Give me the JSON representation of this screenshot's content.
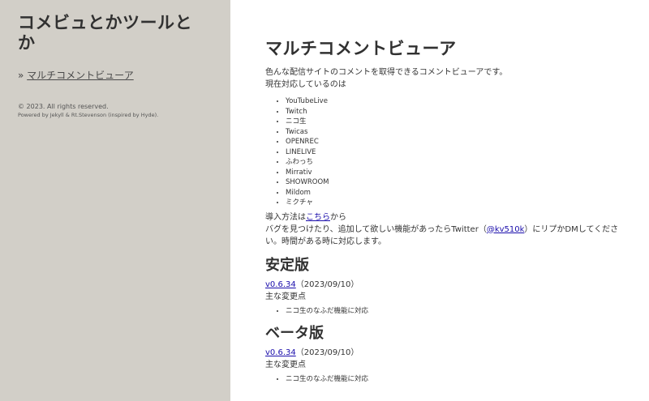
{
  "sidebar": {
    "site_title": "コメビュとかツールとか",
    "nav_prefix": "»",
    "nav_link": "マルチコメントビューア",
    "copyright": "© 2023. All rights reserved.",
    "powered_by": "Powered by Jekyll & Rt.Stevenson (inspired by Hyde)."
  },
  "main": {
    "title": "マルチコメントビューア",
    "intro_line1": "色んな配信サイトのコメントを取得できるコメントビューアです。",
    "intro_line2": "現在対応しているのは",
    "services": [
      "YouTubeLive",
      "Twitch",
      "ニコ生",
      "Twicas",
      "OPENREC",
      "LINELIVE",
      "ふわっち",
      "Mirrativ",
      "SHOWROOM",
      "Mildom",
      "ミクチャ"
    ],
    "install_prefix": "導入方法は",
    "install_link": "こちら",
    "install_suffix": "から",
    "bug_prefix": "バグを見つけたり、追加して欲しい機能があったらTwitter（",
    "twitter_link": "@kv510k",
    "bug_suffix": "）にリプかDMしてください。時間がある時に対応します。",
    "stable": {
      "heading": "安定版",
      "version_link": "v0.6.34",
      "date": "（2023/09/10）",
      "changes_label": "主な変更点",
      "changes": [
        "ニコ生のなふだ機能に対応"
      ]
    },
    "beta": {
      "heading": "ベータ版",
      "version_link": "v0.6.34",
      "date": "（2023/09/10）",
      "changes_label": "主な変更点",
      "changes": [
        "ニコ生のなふだ機能に対応"
      ]
    }
  },
  "colors": {
    "sidebar_bg": "#d2cfc8",
    "link": "#1a0dab"
  }
}
